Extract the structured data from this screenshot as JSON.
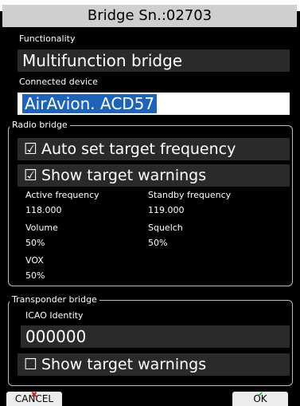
{
  "title": "Bridge Sn.:02703",
  "functionality": {
    "label": "Functionality",
    "value": "Multifunction bridge"
  },
  "connected_device": {
    "label": "Connected device",
    "value": "AirAvion. ACD57"
  },
  "radio_bridge": {
    "legend": "Radio bridge",
    "auto_set": {
      "checked": true,
      "label": "Auto set target frequency"
    },
    "show_warnings": {
      "checked": true,
      "label": "Show target warnings"
    },
    "active_frequency": {
      "label": "Active frequency",
      "value": "118.000"
    },
    "standby_frequency": {
      "label": "Standby frequency",
      "value": "119.000"
    },
    "volume": {
      "label": "Volume",
      "value": "50%"
    },
    "squelch": {
      "label": "Squelch",
      "value": "50%"
    },
    "vox": {
      "label": "VOX",
      "value": "50%"
    }
  },
  "transponder_bridge": {
    "legend": "Transponder bridge",
    "icao": {
      "label": "ICAO Identity",
      "value": "000000"
    },
    "show_warnings": {
      "checked": false,
      "label": "Show target warnings"
    }
  },
  "buttons": {
    "cancel": "CANCEL",
    "ok": "OK"
  },
  "checkbox_glyphs": {
    "checked": "☑",
    "unchecked": "☐"
  }
}
